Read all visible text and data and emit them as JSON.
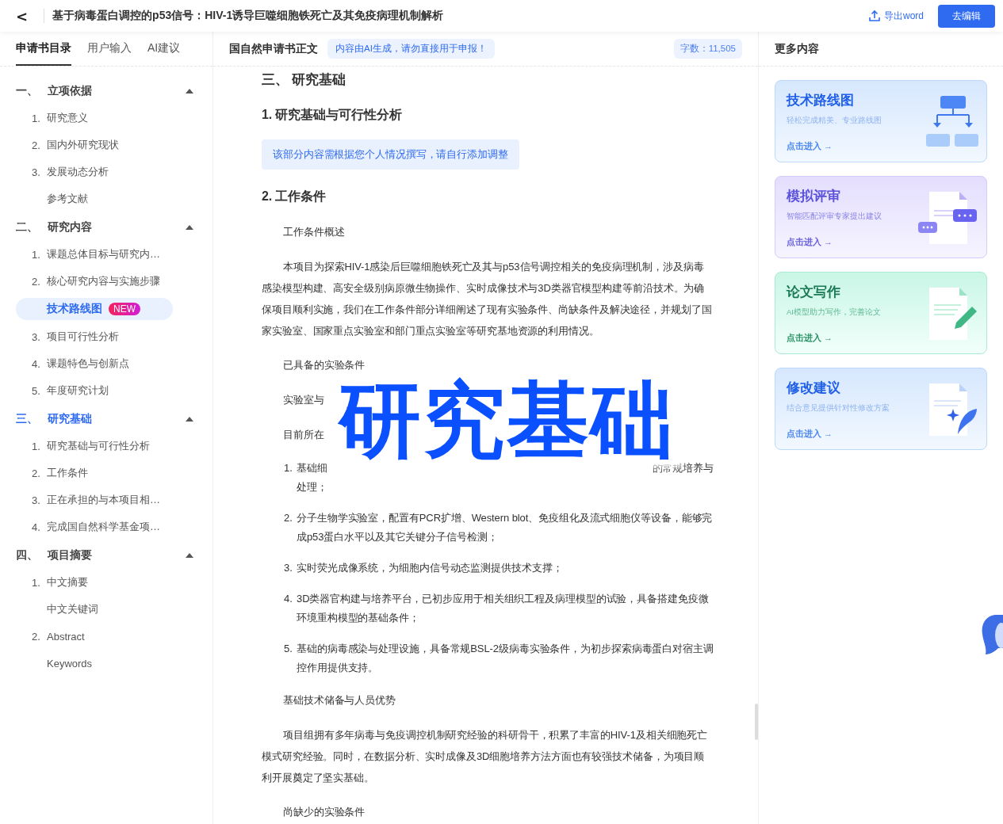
{
  "header": {
    "back": "<",
    "title": "基于病毒蛋白调控的p53信号：HIV-1诱导巨噬细胞铁死亡及其免疫病理机制解析",
    "export": "导出word",
    "edit": "去编辑"
  },
  "sidebar": {
    "tabs": [
      {
        "label": "申请书目录",
        "selected": true
      },
      {
        "label": "用户输入",
        "selected": false
      },
      {
        "label": "AI建议",
        "selected": false
      }
    ],
    "sections": [
      {
        "number": "一、",
        "title": "立项依据",
        "selected": false,
        "expanded": true,
        "children": [
          {
            "number": "1.",
            "label": "研究意义",
            "selected": false
          },
          {
            "number": "2.",
            "label": "国内外研究现状",
            "selected": false
          },
          {
            "number": "3.",
            "label": "发展动态分析",
            "selected": false
          },
          {
            "label": "参考文献",
            "selected": false
          }
        ]
      },
      {
        "number": "二、",
        "title": "研究内容",
        "selected": false,
        "expanded": true,
        "children": [
          {
            "number": "1.",
            "label": "课题总体目标与研究内…",
            "selected": false
          },
          {
            "number": "2.",
            "label": "核心研究内容与实施步骤",
            "selected": false
          },
          {
            "label": "技术路线图",
            "badge": "NEW",
            "selected": true
          },
          {
            "number": "3.",
            "label": "项目可行性分析",
            "selected": false
          },
          {
            "number": "4.",
            "label": "课题特色与创新点",
            "selected": false
          },
          {
            "number": "5.",
            "label": "年度研究计划",
            "selected": false
          }
        ]
      },
      {
        "number": "三、",
        "title": "研究基础",
        "selected": true,
        "expanded": true,
        "children": [
          {
            "number": "1.",
            "label": "研究基础与可行性分析",
            "selected": false
          },
          {
            "number": "2.",
            "label": "工作条件",
            "selected": false
          },
          {
            "number": "3.",
            "label": "正在承担的与本项目相…",
            "selected": false
          },
          {
            "number": "4.",
            "label": "完成国自然科学基金项…",
            "selected": false
          }
        ]
      },
      {
        "number": "四、",
        "title": "项目摘要",
        "selected": false,
        "expanded": true,
        "children": [
          {
            "number": "1.",
            "label": "中文摘要",
            "selected": false
          },
          {
            "label": "中文关键词",
            "selected": false
          },
          {
            "number": "2.",
            "label": "Abstract",
            "selected": false
          },
          {
            "label": "Keywords",
            "selected": false
          }
        ]
      }
    ]
  },
  "main": {
    "title": "国自然申请书正文",
    "notice": "内容由AI生成，请勿直接用于申报！",
    "word_count": "字数：11,505",
    "blocks": [
      {
        "kind": "h2",
        "text": "三、 研究基础"
      },
      {
        "kind": "h3",
        "text": "1. 研究基础与可行性分析"
      },
      {
        "kind": "note",
        "text": "该部分内容需根据您个人情况撰写，请自行添加调整"
      },
      {
        "kind": "h3",
        "text": "2. 工作条件"
      },
      {
        "kind": "label",
        "text": "工作条件概述"
      },
      {
        "kind": "para",
        "text": "本项目为探索HIV-1感染后巨噬细胞铁死亡及其与p53信号调控相关的免疫病理机制，涉及病毒感染模型构建、高安全级别病原微生物操作、实时成像技术与3D类器官模型构建等前沿技术。为确保项目顺利实施，我们在工作条件部分详细阐述了现有实验条件、尚缺条件及解决途径，并规划了国家实验室、国家重点实验室和部门重点实验室等研究基地资源的利用情况。"
      },
      {
        "kind": "label",
        "text": "已具备的实验条件"
      },
      {
        "kind": "label",
        "text": "实验室与"
      },
      {
        "kind": "label",
        "text": "目前所在"
      },
      {
        "kind": "split",
        "number": "1.",
        "start": "基础细",
        "end": "的常规培养与",
        "rest": "处理；"
      },
      {
        "kind": "item",
        "number": "2.",
        "text": "分子生物学实验室，配置有PCR扩增、Western blot、免疫组化及流式细胞仪等设备，能够完成p53蛋白水平以及其它关键分子信号检测；"
      },
      {
        "kind": "item",
        "number": "3.",
        "text": "实时荧光成像系统，为细胞内信号动态监测提供技术支撑；"
      },
      {
        "kind": "item",
        "number": "4.",
        "text": "3D类器官构建与培养平台，已初步应用于相关组织工程及病理模型的试验，具备搭建免疫微环境重构模型的基础条件；"
      },
      {
        "kind": "item",
        "number": "5.",
        "text": "基础的病毒感染与处理设施，具备常规BSL-2级病毒实验条件，为初步探索病毒蛋白对宿主调控作用提供支持。"
      },
      {
        "kind": "label",
        "text": "基础技术储备与人员优势"
      },
      {
        "kind": "para",
        "text": "项目组拥有多年病毒与免疫调控机制研究经验的科研骨干，积累了丰富的HIV-1及相关细胞死亡模式研究经验。同时，在数据分析、实时成像及3D细胞培养方法方面也有较强技术储备，为项目顺利开展奠定了坚实基础。"
      },
      {
        "kind": "label",
        "text": "尚缺少的实验条件"
      }
    ],
    "overlay": "研究基础"
  },
  "more": {
    "title": "更多内容",
    "cards": [
      {
        "kind": "roadmap",
        "title": "技术路线图",
        "subtitle": "轻松完成精美、专业路线图",
        "link": "点击进入 →"
      },
      {
        "kind": "review",
        "title": "模拟评审",
        "subtitle": "智能匹配评审专家提出建议",
        "link": "点击进入 →"
      },
      {
        "kind": "writing",
        "title": "论文写作",
        "subtitle": "AI模型助力写作，完善论文",
        "link": "点击进入 →"
      },
      {
        "kind": "revise",
        "title": "修改建议",
        "subtitle": "结合意见提供针对性修改方案",
        "link": "点击进入 →"
      }
    ]
  }
}
